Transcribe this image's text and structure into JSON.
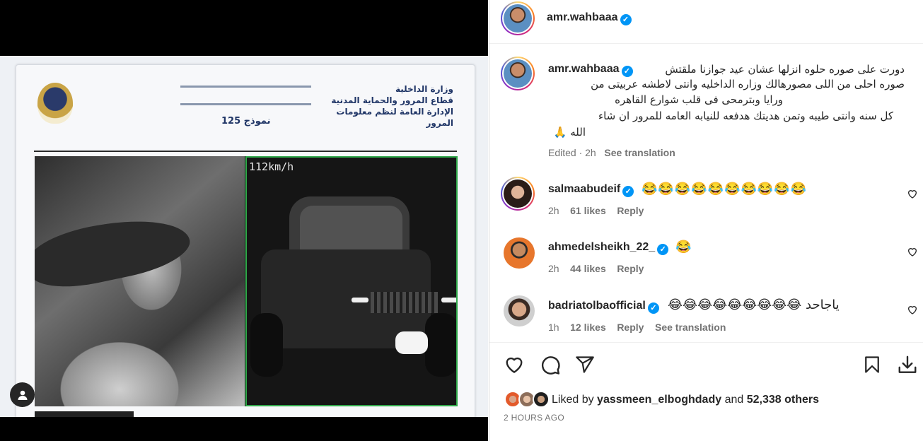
{
  "post": {
    "username": "amr.wahbaaa",
    "caption_lines": [
      "دورت على صوره حلوه انزلها عشان عيد جوازنا ملقتش",
      "صوره احلى من اللى مصورهالك وزاره الداخليه وانتى لاطشه عربيتى من",
      "ورايا وبترمحى فى قلب شوارع القاهره",
      "كل سنه وانتى طيبه وتمن هديتك هدفعه للنيابه العامه للمرور ان شاء",
      "الله 🙏"
    ],
    "edited_label": "Edited · 2h",
    "see_translation": "See translation",
    "liked_by_prefix": "Liked by",
    "liked_by_user": "yassmeen_elboghdady",
    "liked_by_and": "and",
    "liked_by_others": "52,338 others",
    "time_ago": "2 HOURS AGO"
  },
  "media": {
    "ministry_lines": [
      "وزارة الداخلية",
      "قطاع المرور والحماية المدنية",
      "الإدارة العامة لنظم معلومات",
      "المرور"
    ],
    "form_number": "نموذج 125",
    "speed_overlay": "112km/h"
  },
  "comments": [
    {
      "username": "salmaabudeif",
      "text": "😂😂😂😂😂😂😂😂😂😂",
      "time": "2h",
      "likes": "61 likes",
      "reply": "Reply",
      "translate": ""
    },
    {
      "username": "ahmedelsheikh_22_",
      "text": "😂",
      "time": "2h",
      "likes": "44 likes",
      "reply": "Reply",
      "translate": ""
    },
    {
      "username": "badriatolbaofficial",
      "text": "ياجاحد 😂😂😂😂😂😂😂😂😂",
      "time": "1h",
      "likes": "12 likes",
      "reply": "Reply",
      "translate": "See translation"
    }
  ],
  "icons": {
    "verified": "verified-badge-icon",
    "heart": "heart-icon",
    "comment": "comment-icon",
    "share": "share-icon",
    "save": "bookmark-icon",
    "download": "download-icon",
    "user_tag": "user-tag-icon"
  },
  "colors": {
    "verified": "#0095f6",
    "muted": "#737373",
    "text": "#262626"
  }
}
